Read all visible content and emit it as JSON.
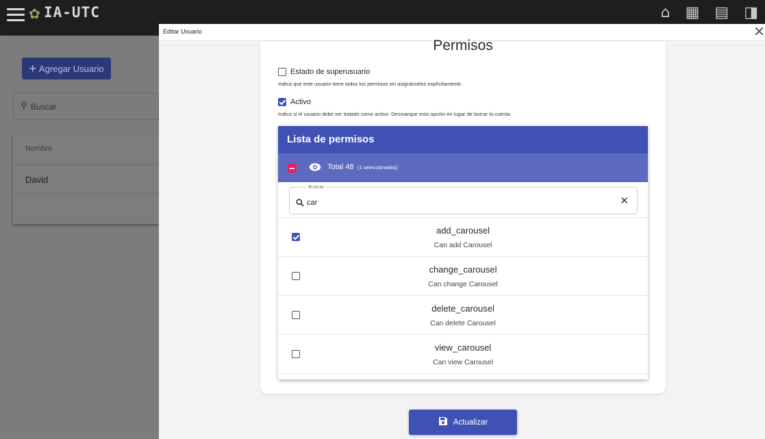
{
  "app": {
    "title": "IA-UTC",
    "add_user_label": "Agregar Usuario",
    "search_placeholder": "Buscar",
    "table_header_name": "Nombre",
    "table_rows": [
      "David"
    ]
  },
  "modal": {
    "title": "Editar Usuario",
    "heading": "Permisos",
    "superuser": {
      "label": "Estado de superusuario",
      "help": "Indica que este usuario tiene todos los permisos sin asignárselos explícitamente.",
      "checked": false
    },
    "active": {
      "label": "Activo",
      "help": "Indica si el usuario debe ser tratado como activo. Desmarque esta opción en lugar de borrar la cuenta.",
      "checked": true
    },
    "permission_list": {
      "title": "Lista de permisos",
      "total_label": "Total 48",
      "selected_label": "(1 seleccionados)",
      "search_label": "Buscar",
      "search_value": "car",
      "items": [
        {
          "name": "add_carousel",
          "desc": "Can add Carousel",
          "checked": true
        },
        {
          "name": "change_carousel",
          "desc": "Can change Carousel",
          "checked": false
        },
        {
          "name": "delete_carousel",
          "desc": "Can delete Carousel",
          "checked": false
        },
        {
          "name": "view_carousel",
          "desc": "Can view Carousel",
          "checked": false
        }
      ]
    },
    "update_label": "Actualizar"
  },
  "colors": {
    "primary": "#3f51b5",
    "primary_light": "#5c6bc0",
    "indeterminate": "#e91e63"
  }
}
